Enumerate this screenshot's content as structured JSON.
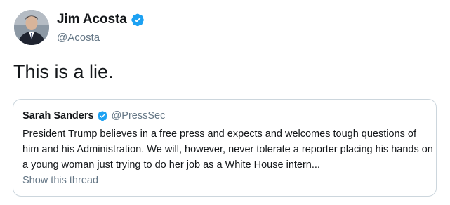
{
  "author": {
    "display_name": "Jim Acosta",
    "handle": "@Acosta",
    "verified": true
  },
  "tweet": {
    "text": "This is a lie."
  },
  "quoted_tweet": {
    "display_name": "Sarah Sanders",
    "handle": "@PressSec",
    "verified": true,
    "text": "President Trump believes in a free press and expects and welcomes tough questions of him and his Administration. We will, however, never tolerate a reporter placing his hands on a young woman just trying to do her job as a White House intern...",
    "show_thread_label": "Show this thread"
  },
  "colors": {
    "text_primary": "#14171a",
    "text_secondary": "#657786",
    "verified_blue": "#1da1f2",
    "border": "#ccd6dd"
  },
  "icons": {
    "verified": "verified-badge-icon",
    "avatar": "profile-photo"
  }
}
